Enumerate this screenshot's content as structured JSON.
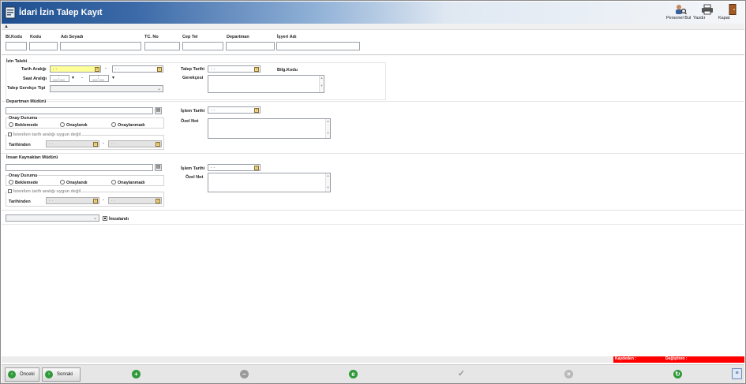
{
  "window": {
    "title": "İdari İzin Talep Kayıt"
  },
  "toolbar": {
    "find_label": "Personel Bul",
    "print_label": "Yazdır",
    "close_label": "Kapat"
  },
  "header": {
    "cols": [
      "Bl.Kodu",
      "Kodu",
      "Adı Soyadı",
      "TC. No",
      "Cep Tel",
      "Departman",
      "İşyeri Adı"
    ]
  },
  "izin": {
    "section": "İzin Talebi",
    "date_range_label": "Tarih Aralığı",
    "date_from": ". .",
    "date_to": ". .",
    "time_range_label": "Saat Aralığı",
    "time_from": "__:__",
    "time_to": "__:__",
    "reason_type_label": "Talep Gerekçe Tipi",
    "reason_type_value": "",
    "request_date_label": "Talep Tarihi",
    "request_date": ". .",
    "bilg_kodu_label": "Bilg.Kodu",
    "reason_label": "Gerekçesi"
  },
  "dept": {
    "section": "Departman Müdürü",
    "approval_label": "Onay Durumu",
    "opt_waiting": "Beklemede",
    "opt_approved": "Onaylandı",
    "opt_rejected": "Onaylanmadı",
    "not_suitable": "İstenilen tarih aralığı uygun değil",
    "dates_label": "Tarihinden",
    "date_from": ". .",
    "date_to": ". .",
    "process_date_label": "İşlem Tarihi",
    "process_date": ". .",
    "note_label": "Özel Not"
  },
  "hr": {
    "section": "İnsan Kaynakları Müdürü",
    "approval_label": "Onay Durumu",
    "opt_waiting": "Beklemede",
    "opt_approved": "Onaylandı",
    "opt_rejected": "Onaylanmadı",
    "not_suitable": "İstenilen tarih aralığı uygun değil",
    "dates_label": "Tarihinden",
    "date_from": ". .",
    "date_to": ". .",
    "process_date_label": "İşlem Tarihi",
    "process_date": ". .",
    "note_label": "Özel Not"
  },
  "signed": {
    "label": "İmzalandı"
  },
  "status": {
    "created_label": "Kaydeden :",
    "modified_label": "Değiştiren :"
  },
  "bottom": {
    "prev_label": "Önceki",
    "next_label": "Sonraki"
  }
}
